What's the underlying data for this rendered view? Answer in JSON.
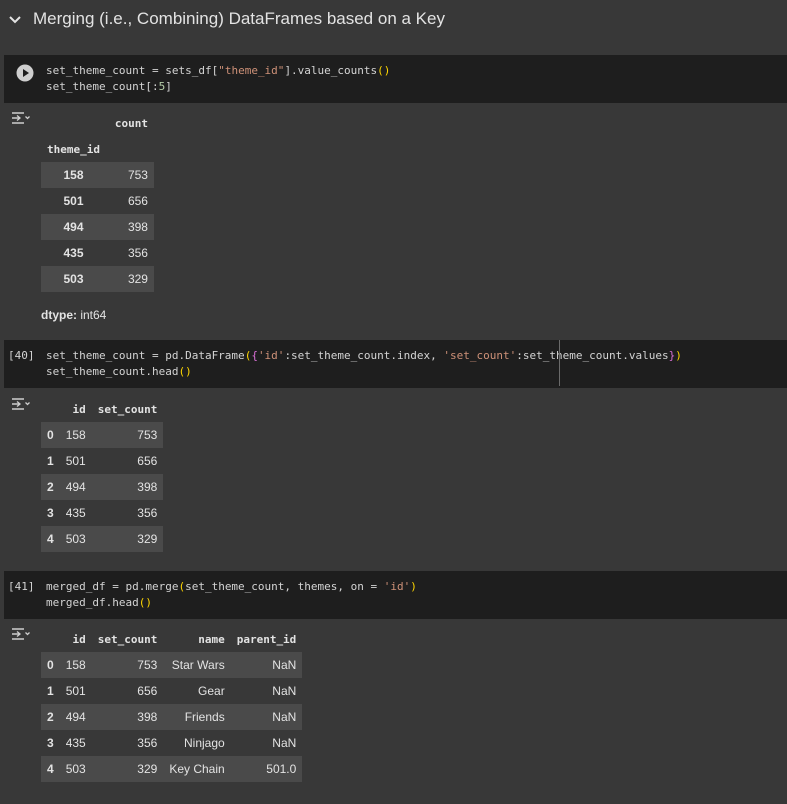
{
  "section": {
    "title": "Merging (i.e., Combining) DataFrames based on a Key"
  },
  "cell1": {
    "code_lines": [
      [
        [
          "set_theme_count = sets_df",
          "plain"
        ],
        [
          "[",
          "plain"
        ],
        [
          "\"theme_id\"",
          "str"
        ],
        [
          "].value_counts",
          "plain"
        ],
        [
          "()",
          "br1"
        ]
      ],
      [
        [
          "set_theme_count",
          "plain"
        ],
        [
          "[:",
          "plain"
        ],
        [
          "5",
          "num"
        ],
        [
          "]",
          "plain"
        ]
      ]
    ],
    "output": {
      "column_header": "count",
      "index_name": "theme_id",
      "rows": [
        {
          "index": "158",
          "count": "753"
        },
        {
          "index": "501",
          "count": "656"
        },
        {
          "index": "494",
          "count": "398"
        },
        {
          "index": "435",
          "count": "356"
        },
        {
          "index": "503",
          "count": "329"
        }
      ],
      "dtype_label": "dtype:",
      "dtype_value": " int64"
    }
  },
  "cell2": {
    "exec_count": "[40]",
    "code_lines": [
      [
        [
          "set_theme_count = pd.DataFrame",
          "plain"
        ],
        [
          "(",
          "br1"
        ],
        [
          "{",
          "br2"
        ],
        [
          "'id'",
          "str"
        ],
        [
          ":set_theme_count.index, ",
          "plain"
        ],
        [
          "'set_count'",
          "str"
        ],
        [
          ":set_theme_count.values",
          "plain"
        ],
        [
          "}",
          "br2"
        ],
        [
          ")",
          "br1"
        ]
      ],
      [
        [
          "set_theme_count.head",
          "plain"
        ],
        [
          "()",
          "br1"
        ]
      ]
    ],
    "output": {
      "columns": [
        "",
        "id",
        "set_count"
      ],
      "rows": [
        [
          "0",
          "158",
          "753"
        ],
        [
          "1",
          "501",
          "656"
        ],
        [
          "2",
          "494",
          "398"
        ],
        [
          "3",
          "435",
          "356"
        ],
        [
          "4",
          "503",
          "329"
        ]
      ]
    }
  },
  "cell3": {
    "exec_count": "[41]",
    "code_lines": [
      [
        [
          "merged_df = pd.merge",
          "plain"
        ],
        [
          "(",
          "br1"
        ],
        [
          "set_theme_count, themes, on = ",
          "plain"
        ],
        [
          "'id'",
          "str"
        ],
        [
          ")",
          "br1"
        ]
      ],
      [
        [
          "merged_df.head",
          "plain"
        ],
        [
          "()",
          "br1"
        ]
      ]
    ],
    "output": {
      "columns": [
        "",
        "id",
        "set_count",
        "name",
        "parent_id"
      ],
      "rows": [
        [
          "0",
          "158",
          "753",
          "Star Wars",
          "NaN"
        ],
        [
          "1",
          "501",
          "656",
          "Gear",
          "NaN"
        ],
        [
          "2",
          "494",
          "398",
          "Friends",
          "NaN"
        ],
        [
          "3",
          "435",
          "356",
          "Ninjago",
          "NaN"
        ],
        [
          "4",
          "503",
          "329",
          "Key Chain",
          "501.0"
        ]
      ]
    }
  },
  "icons": {
    "section_toggle": "chevron-down-icon",
    "run": "run-play-icon",
    "output_toggle": "output-toggle-icon"
  },
  "colors": {
    "page_bg": "#383838",
    "code_bg": "#1e1e1e",
    "string": "#ce9178",
    "number": "#b5cea8",
    "bracket1": "#ffd700",
    "bracket2": "#da70d6",
    "row_stripe": "#4a4a4a"
  }
}
